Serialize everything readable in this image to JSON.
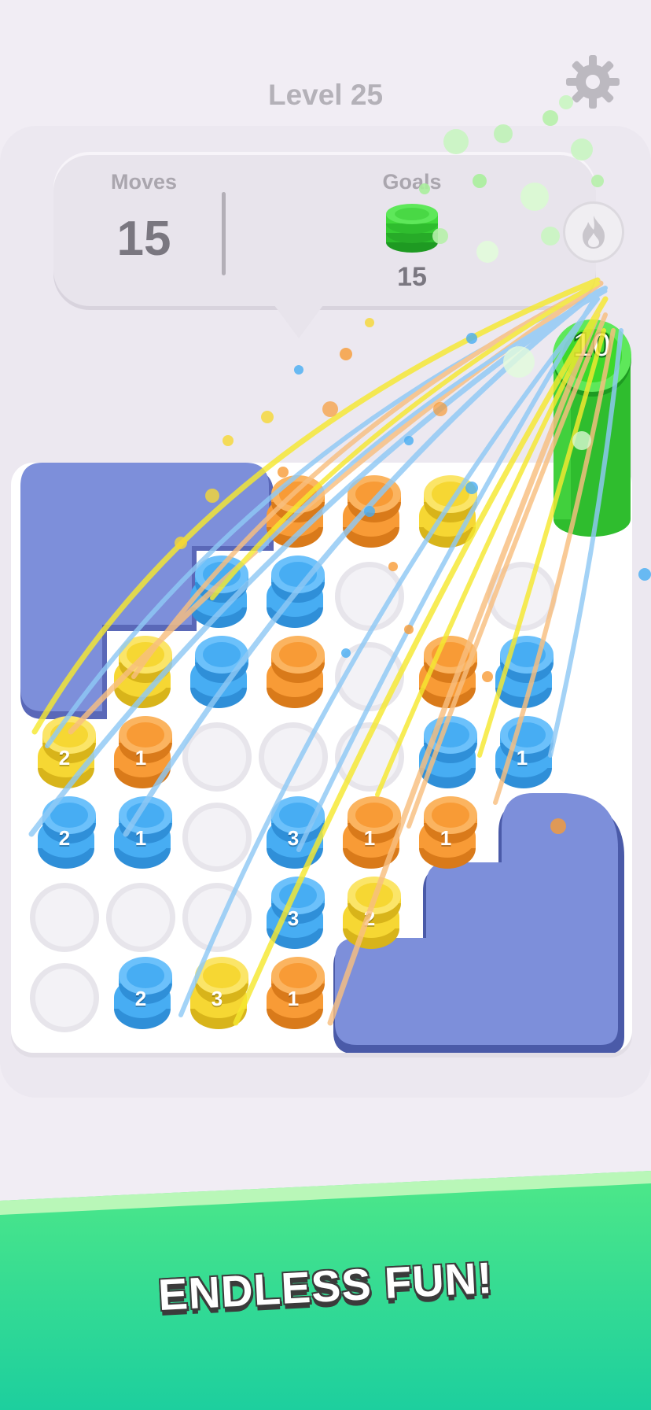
{
  "header": {
    "level_title": "Level 25",
    "settings_icon": "gear-icon"
  },
  "stats": {
    "moves_label": "Moves",
    "moves_value": "15",
    "goals_label": "Goals",
    "goals_value": "15",
    "goals_icon": "green-coin-stack-icon",
    "booster_icon": "flame-icon"
  },
  "tower": {
    "count": "10",
    "color": "#3cd92b"
  },
  "colors": {
    "blue": "#47adf3",
    "orange": "#f89b36",
    "yellow": "#f6d733",
    "green": "#3cd92b",
    "blocked": "#7d8fda"
  },
  "board": {
    "stacks": [
      {
        "cell": "0,3",
        "color": "orange",
        "label": ""
      },
      {
        "cell": "0,4",
        "color": "orange",
        "label": ""
      },
      {
        "cell": "0,5",
        "color": "yellow",
        "label": ""
      },
      {
        "cell": "1,2",
        "color": "blue",
        "label": ""
      },
      {
        "cell": "1,3",
        "color": "blue",
        "label": ""
      },
      {
        "cell": "2,1",
        "color": "yellow",
        "label": ""
      },
      {
        "cell": "2,2",
        "color": "blue",
        "label": ""
      },
      {
        "cell": "2,3",
        "color": "orange",
        "label": ""
      },
      {
        "cell": "2,5",
        "color": "orange",
        "label": ""
      },
      {
        "cell": "2,6",
        "color": "blue",
        "label": ""
      },
      {
        "cell": "3,0",
        "color": "yellow",
        "label": "2"
      },
      {
        "cell": "3,1",
        "color": "orange",
        "label": "1"
      },
      {
        "cell": "3,5",
        "color": "blue",
        "label": ""
      },
      {
        "cell": "3,6",
        "color": "blue",
        "label": "1"
      },
      {
        "cell": "4,0",
        "color": "blue",
        "label": "2"
      },
      {
        "cell": "4,1",
        "color": "blue",
        "label": "1"
      },
      {
        "cell": "4,3",
        "color": "blue",
        "label": "3"
      },
      {
        "cell": "4,4",
        "color": "orange",
        "label": "1"
      },
      {
        "cell": "4,5",
        "color": "orange",
        "label": "1"
      },
      {
        "cell": "5,3",
        "color": "blue",
        "label": "3"
      },
      {
        "cell": "5,4",
        "color": "yellow",
        "label": "2"
      },
      {
        "cell": "6,1",
        "color": "blue",
        "label": "2"
      },
      {
        "cell": "6,2",
        "color": "yellow",
        "label": "3"
      },
      {
        "cell": "6,3",
        "color": "orange",
        "label": "1"
      }
    ],
    "empty_slots": [
      "1,4",
      "1,6",
      "2,4",
      "3,2",
      "3,3",
      "3,4",
      "4,2",
      "5,0",
      "5,1",
      "5,2",
      "6,0"
    ]
  },
  "footer": {
    "tagline": "ENDLESS FUN!"
  }
}
